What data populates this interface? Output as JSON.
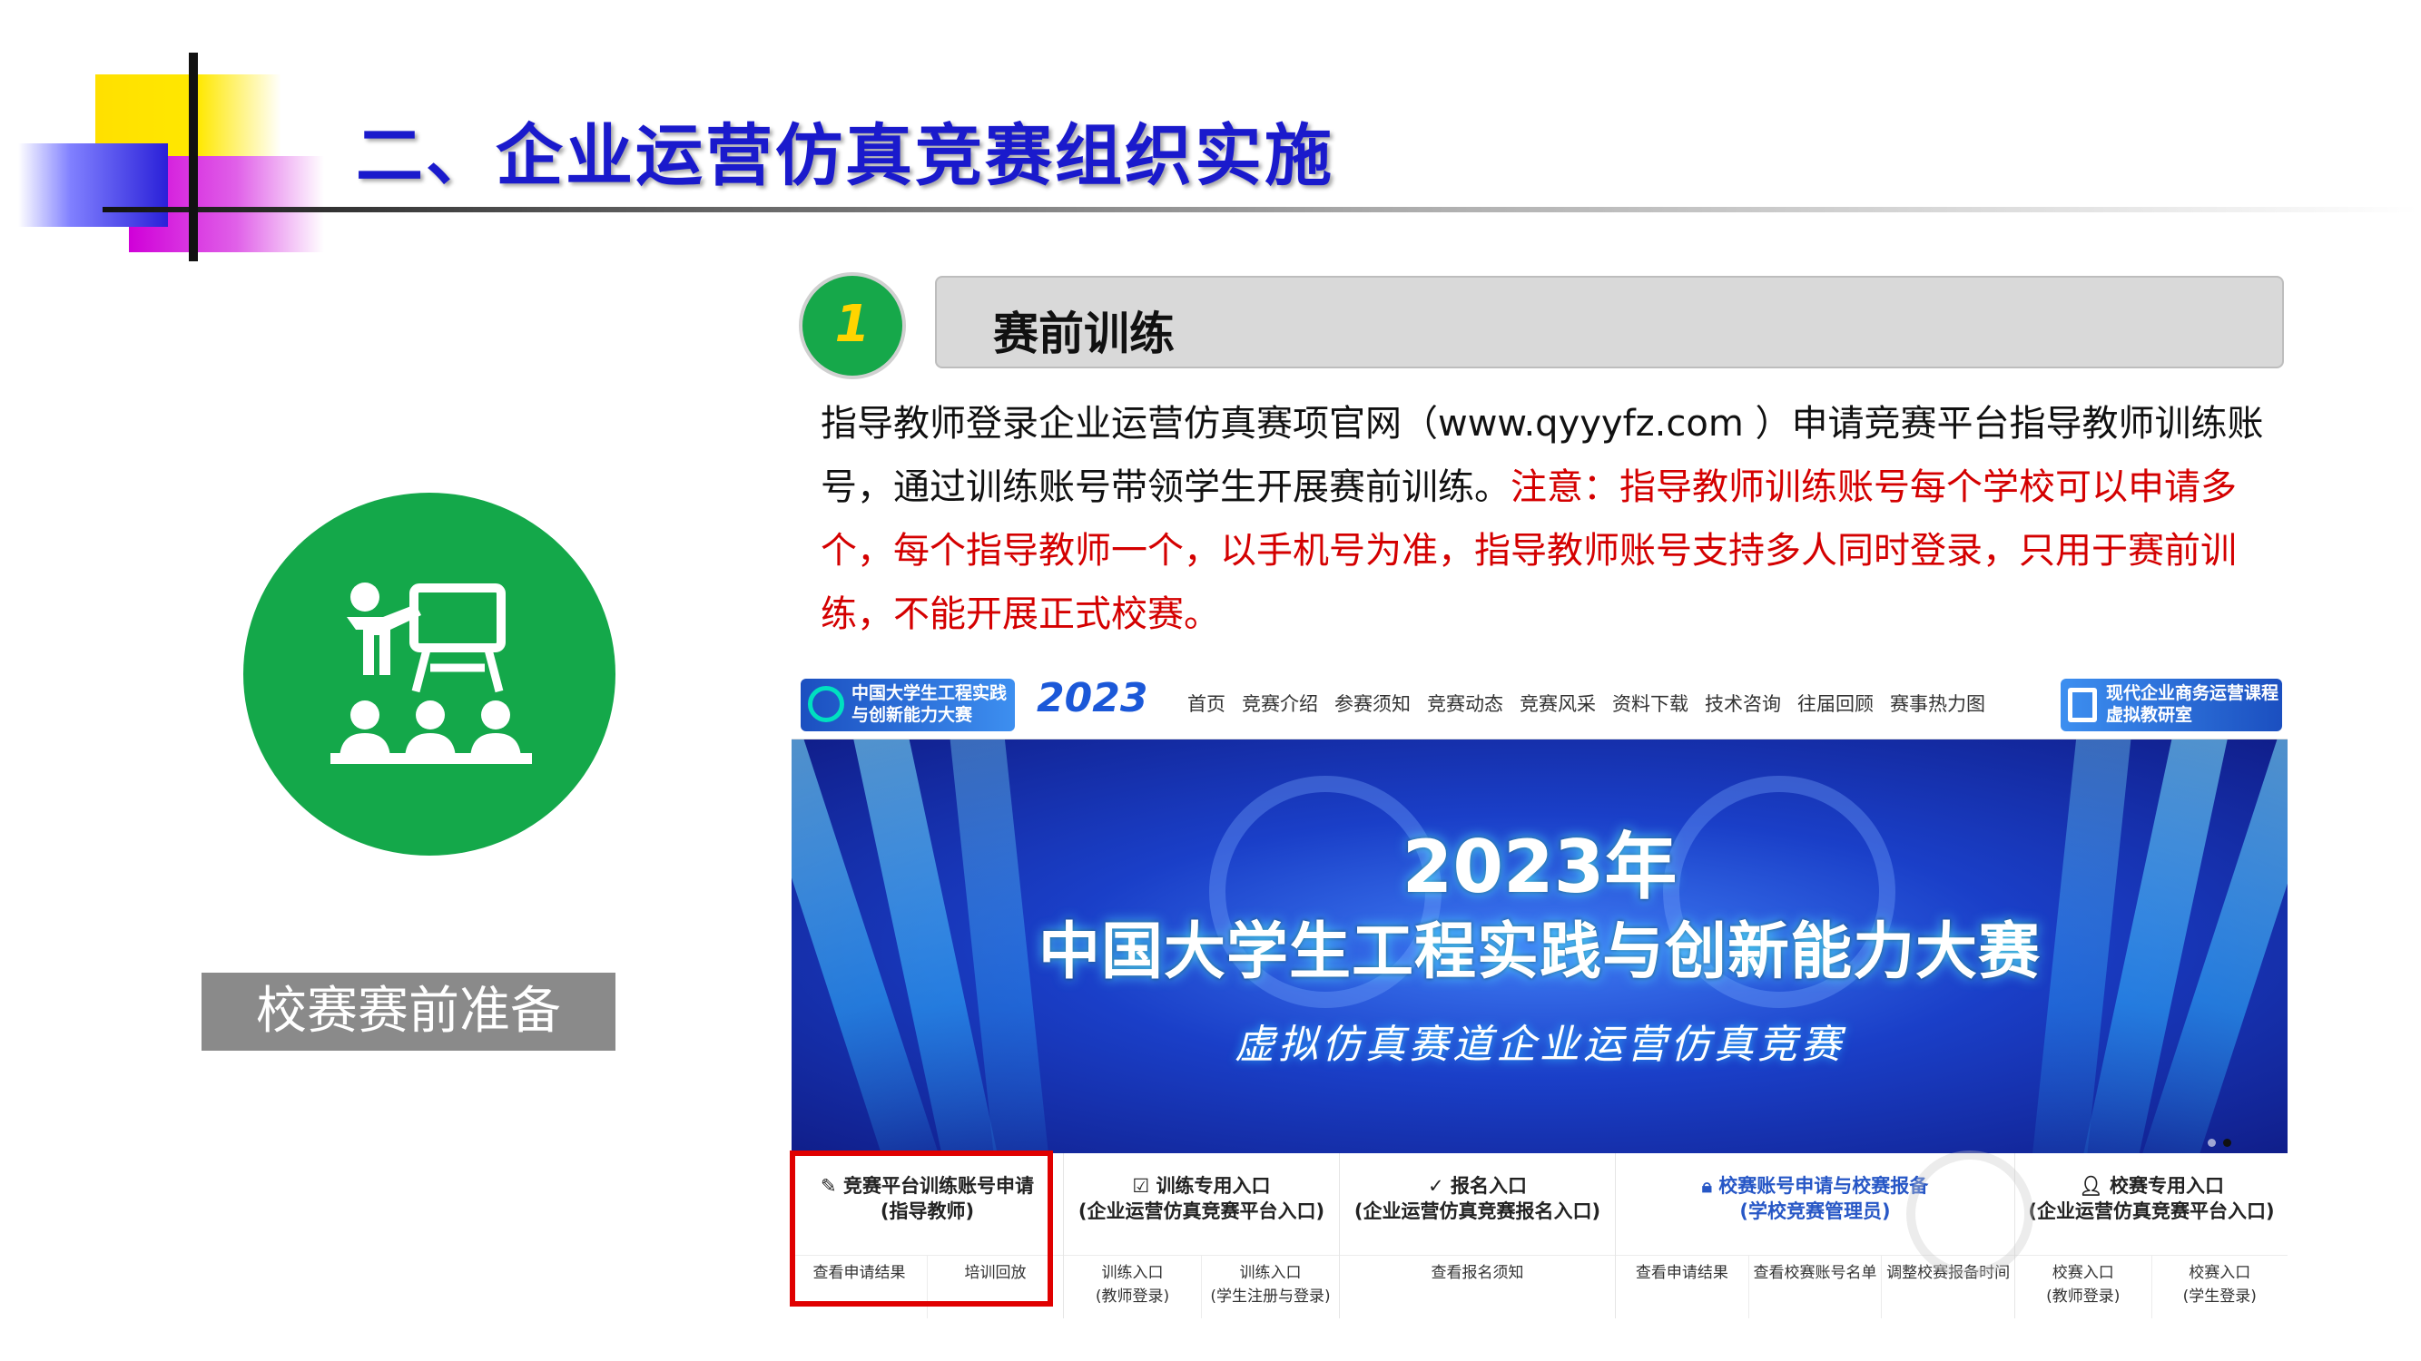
{
  "slide": {
    "title": "二、企业运营仿真竞赛组织实施",
    "side_label": "校赛赛前准备",
    "step_number": "1",
    "step_title": "赛前训练",
    "paragraph_normal": "指导教师登录企业运营仿真赛项官网（www.qyyyfz.com ）申请竞赛平台指导教师训练账号，通过训练账号带领学生开展赛前训练。",
    "paragraph_red": "注意：指导教师训练账号每个学校可以申请多个，每个指导教师一个，以手机号为准，指导教师账号支持多人同时登录，只用于赛前训练，不能开展正式校赛。",
    "colors": {
      "title": "#1a1acc",
      "green": "#14a84a",
      "red_text": "#d40000",
      "highlight_box": "#e00000"
    }
  },
  "website": {
    "logo_left": "中国大学生工程实践与创新能力大赛",
    "logo_year": "2023",
    "nav": [
      "首页",
      "竞赛介绍",
      "参赛须知",
      "竞赛动态",
      "竞赛风采",
      "资料下载",
      "技术咨询",
      "往届回顾",
      "赛事热力图"
    ],
    "logo_right": "现代企业商务运营课程虚拟教研室",
    "banner": {
      "year": "2023年",
      "title": "中国大学生工程实践与创新能力大赛",
      "subtitle": "虚拟仿真赛道企业运营仿真竞赛"
    },
    "cards": [
      {
        "icon": "pen-icon",
        "head": "竞赛平台训练账号申请",
        "sub": "(指导教师)",
        "links": [
          "查看申请结果",
          "培训回放"
        ]
      },
      {
        "icon": "checkbox-icon",
        "head": "训练专用入口",
        "sub": "(企业运营仿真竞赛平台入口)",
        "links": [
          "训练入口\n(教师登录)",
          "训练入口\n(学生注册与登录)"
        ]
      },
      {
        "icon": "check-icon",
        "head": "报名入口",
        "sub": "(企业运营仿真竞赛报名入口)",
        "links": [
          "查看报名须知"
        ]
      },
      {
        "icon": "lock-icon",
        "head": "校赛账号申请与校赛报备",
        "sub": "(学校竞赛管理员)",
        "links": [
          "查看申请结果",
          "查看校赛账号名单",
          "调整校赛报备时间"
        ]
      },
      {
        "icon": "user-icon",
        "head": "校赛专用入口",
        "sub": "(企业运营仿真竞赛平台入口)",
        "links": [
          "校赛入口\n(教师登录)",
          "校赛入口\n(学生登录)"
        ]
      }
    ]
  }
}
